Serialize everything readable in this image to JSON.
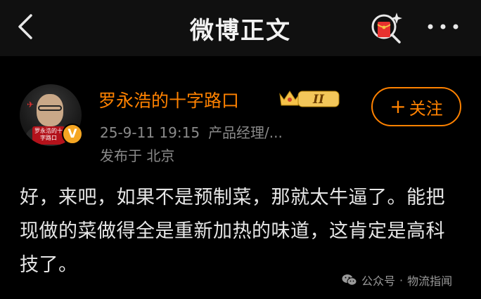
{
  "header": {
    "title": "微博正文",
    "back_icon": "chevron-left-icon",
    "redpacket_icon": "red-packet-search-icon",
    "more_icon": "more-dots-icon"
  },
  "author": {
    "name": "罗永浩的十字路口",
    "avatar_caption": "罗永浩的十字路口",
    "verified_mark": "V",
    "vip_level": "II",
    "vip_icon": "crown-icon",
    "date": "25-9-11 19:15",
    "role": "产品经理/...",
    "location": "发布于 北京"
  },
  "follow": {
    "plus": "+",
    "label": "关注"
  },
  "post": {
    "text": "好，来吧，如果不是预制菜，那就太牛逼了。能把现做的菜做得全是重新加热的味道，这肯定是高科技了。"
  },
  "watermark": {
    "source": "公众号",
    "separator": "·",
    "account": "物流指闻",
    "icon": "wechat-icon"
  },
  "colors": {
    "accent": "#ff8200",
    "background": "#000000",
    "text": "#e6e6e6",
    "muted": "#8a8a8a"
  }
}
